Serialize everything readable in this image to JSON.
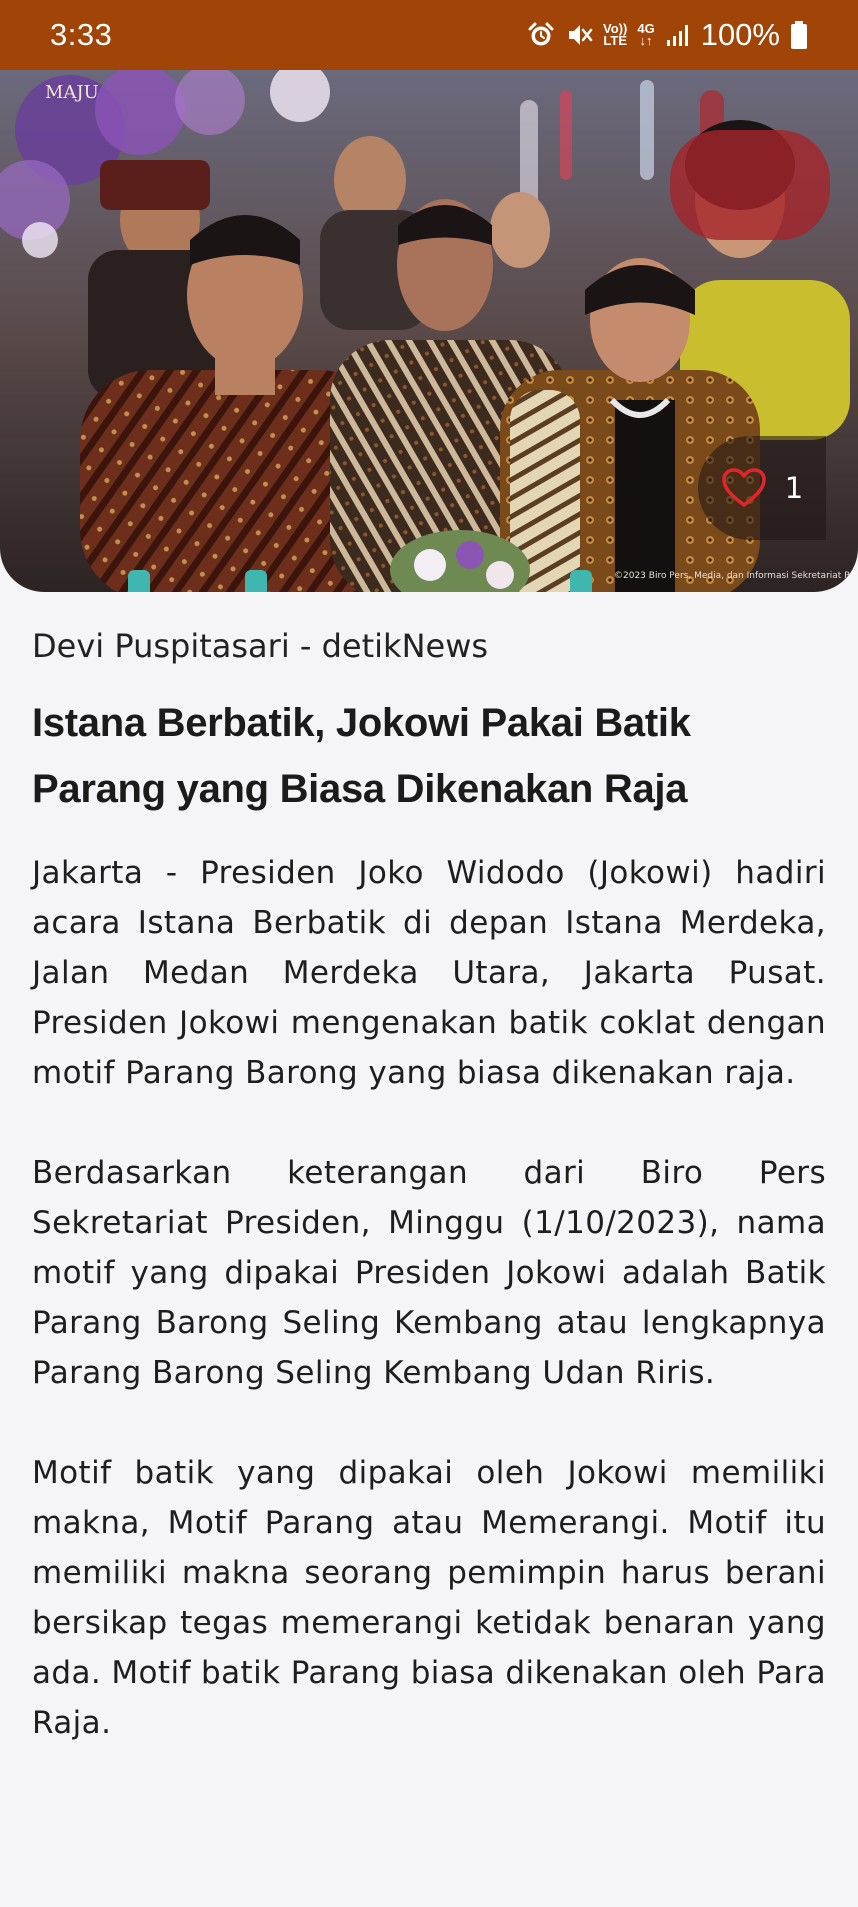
{
  "status_bar": {
    "time": "3:33",
    "volte_label_top": "Vo))",
    "volte_label_bottom": "LTE",
    "network_label": "4G",
    "battery_text": "100%",
    "icons": [
      "alarm-icon",
      "mute-icon",
      "volte-icon",
      "4g-icon",
      "signal-icon",
      "battery-icon"
    ],
    "background_color": "#a14408"
  },
  "hero": {
    "image_description_icon": "photo",
    "watermark_top_left": "MAJU",
    "watermark_bottom_right": "©2023 Biro Pers, Media, dan Informasi Sekretariat P",
    "like_count": "1",
    "like_icon": "heart-outline-icon",
    "like_color": "#e0262b"
  },
  "article": {
    "byline": "Devi Puspitasari - detikNews",
    "headline": "Istana Berbatik, Jokowi Pakai Batik Parang yang Biasa Dikenakan Raja",
    "paragraphs": [
      "Jakarta - Presiden Joko Widodo (Jokowi) hadiri acara Istana Berbatik di depan Istana Merdeka, Jalan Medan Merdeka Utara, Jakarta Pusat. Presiden Jokowi mengenakan batik coklat dengan motif Parang Barong yang biasa dikenakan raja.",
      "Berdasarkan keterangan dari Biro Pers Sekretariat Presiden, Minggu (1/10/2023), nama motif yang dipakai Presiden Jokowi adalah Batik Parang Barong Seling Kembang atau lengkapnya Parang Barong Seling Kembang Udan Riris.",
      "Motif batik yang dipakai oleh Jokowi memiliki makna, Motif Parang atau Memerangi. Motif itu memiliki makna seorang pemimpin harus berani bersikap tegas memerangi ketidak benaran yang ada. Motif batik Parang biasa dikenakan oleh Para Raja."
    ]
  }
}
